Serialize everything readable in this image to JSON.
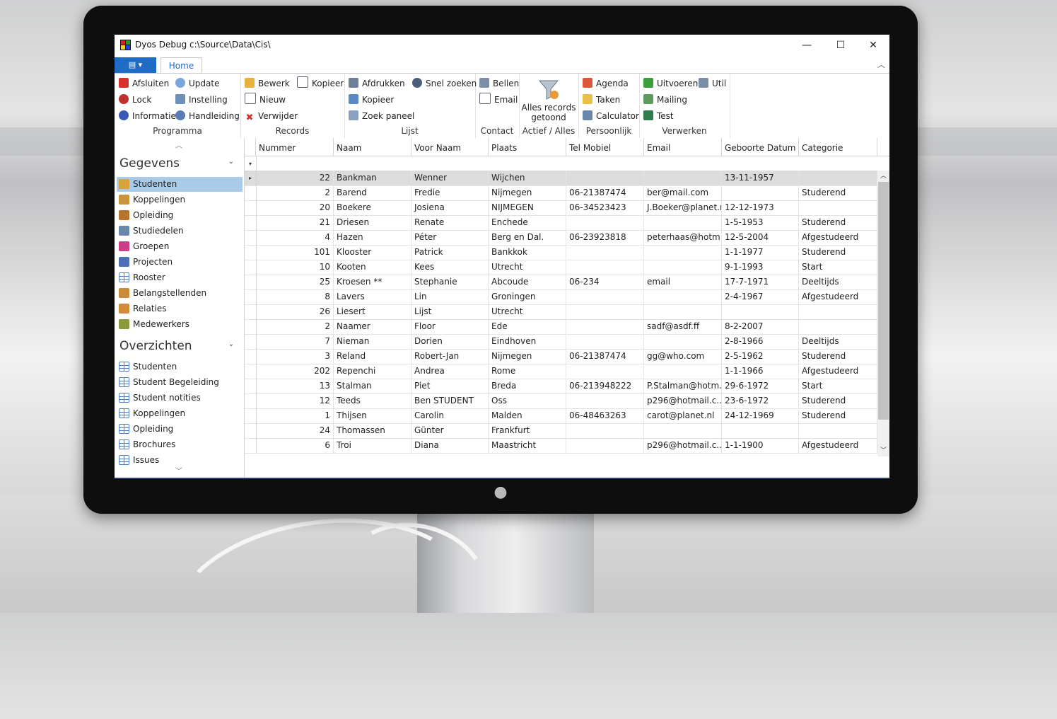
{
  "window": {
    "title": "Dyos Debug c:\\Source\\Data\\Cis\\",
    "minimize": "—",
    "maximize": "☐",
    "close": "✕"
  },
  "ribbon": {
    "file_glyph": "▤ ▾",
    "home_tab": "Home",
    "collapse_glyph": "︿",
    "groups": {
      "programma": {
        "label": "Programma",
        "buttons": [
          "Afsluiten",
          "Update",
          "Lock",
          "Instelling",
          "Informatie",
          "Handleiding"
        ]
      },
      "records": {
        "label": "Records",
        "buttons": [
          "Bewerk",
          "Kopieer",
          "Nieuw",
          "Verwijder"
        ]
      },
      "lijst": {
        "label": "Lijst",
        "buttons": [
          "Afdrukken",
          "Snel zoeken",
          "Kopieer",
          "Zoek paneel"
        ]
      },
      "contact": {
        "label": "Contact",
        "buttons": [
          "Bellen",
          "Email"
        ]
      },
      "actief": {
        "label": "Actief / Alles",
        "big_button_line1": "Alles records",
        "big_button_line2": "getoond"
      },
      "persoonlijk": {
        "label": "Persoonlijk",
        "buttons": [
          "Agenda",
          "Taken",
          "Calculator"
        ]
      },
      "verwerken": {
        "label": "Verwerken",
        "buttons": [
          "Uitvoeren",
          "Util",
          "Mailing",
          "Test"
        ]
      }
    }
  },
  "nav": {
    "scroll_up": "︿",
    "scroll_down": "﹀",
    "gegevens_title": "Gegevens",
    "gegevens_items": [
      "Studenten",
      "Koppelingen",
      "Opleiding",
      "Studiedelen",
      "Groepen",
      "Projecten",
      "Rooster",
      "Belangstellenden",
      "Relaties",
      "Medewerkers"
    ],
    "overzichten_title": "Overzichten",
    "overzichten_items": [
      "Studenten",
      "Student Begeleiding",
      "Student notities",
      "Koppelingen",
      "Opleiding",
      "Brochures",
      "Issues"
    ],
    "chevron": "⌄"
  },
  "grid": {
    "columns": [
      "Nummer",
      "Naam",
      "Voor Naam",
      "Plaats",
      "Tel Mobiel",
      "Email",
      "Geboorte Datum",
      "Categorie"
    ],
    "filter_glyph": "▾",
    "current_row_glyph": "▸",
    "rows": [
      [
        "22",
        "Bankman",
        "Wenner",
        "Wijchen",
        "",
        "",
        "13-11-1957",
        ""
      ],
      [
        "2",
        "Barend",
        "Fredie",
        "Nijmegen",
        "06-21387474",
        "ber@mail.com",
        "",
        "Studerend"
      ],
      [
        "20",
        "Boekere",
        "Josiena",
        "NIJMEGEN",
        "06-34523423",
        "J.Boeker@planet.nl",
        "12-12-1973",
        ""
      ],
      [
        "21",
        "Driesen",
        "Renate",
        "Enchede",
        "",
        "",
        "1-5-1953",
        "Studerend"
      ],
      [
        "4",
        "Hazen",
        "Péter",
        "Berg en Dal.",
        "06-23923818",
        "peterhaas@hotm...",
        "12-5-2004",
        "Afgestudeerd"
      ],
      [
        "101",
        "Klooster",
        "Patrick",
        "Bankkok",
        "",
        "",
        "1-1-1977",
        "Studerend"
      ],
      [
        "10",
        "Kooten",
        "Kees",
        "Utrecht",
        "",
        "",
        "9-1-1993",
        "Start"
      ],
      [
        "25",
        "Kroesen **",
        "Stephanie",
        "Abcoude",
        "06-234",
        "email",
        "17-7-1971",
        "Deeltijds"
      ],
      [
        "8",
        "Lavers",
        "Lin",
        "Groningen",
        "",
        "",
        "2-4-1967",
        "Afgestudeerd"
      ],
      [
        "26",
        "Liesert",
        "Lijst",
        "Utrecht",
        "",
        "",
        "",
        ""
      ],
      [
        "2",
        "Naamer",
        "Floor",
        "Ede",
        "",
        "sadf@asdf.ff",
        "8-2-2007",
        ""
      ],
      [
        "7",
        "Nieman",
        "Dorien",
        "Eindhoven",
        "",
        "",
        "2-8-1966",
        "Deeltijds"
      ],
      [
        "3",
        "Reland",
        "Robert-Jan",
        "Nijmegen",
        "06-21387474",
        "gg@who.com",
        "2-5-1962",
        "Studerend"
      ],
      [
        "202",
        "Repenchi",
        "Andrea",
        "Rome",
        "",
        "",
        "1-1-1966",
        "Afgestudeerd"
      ],
      [
        "13",
        "Stalman",
        "Piet",
        "Breda",
        "06-213948222",
        "P.Stalman@hotm...",
        "29-6-1972",
        "Start"
      ],
      [
        "12",
        "Teeds",
        "Ben STUDENT",
        "Oss",
        "",
        "p296@hotmail.c...",
        "23-6-1972",
        "Studerend"
      ],
      [
        "1",
        "Thijsen",
        "Carolin",
        "Malden",
        "06-48463263",
        "carot@planet.nl",
        "24-12-1969",
        "Studerend"
      ],
      [
        "24",
        "Thomassen",
        "Günter",
        "Frankfurt",
        "",
        "",
        "",
        ""
      ],
      [
        "6",
        "Troi",
        "Diana",
        "Maastricht",
        "",
        "p296@hotmail.c...",
        "1-1-1900",
        "Afgestudeerd"
      ]
    ],
    "scroll_up": "︿",
    "scroll_down": "﹀"
  },
  "colors": {
    "accent": "#1e6cc4",
    "selection": "#a9cbe8"
  }
}
